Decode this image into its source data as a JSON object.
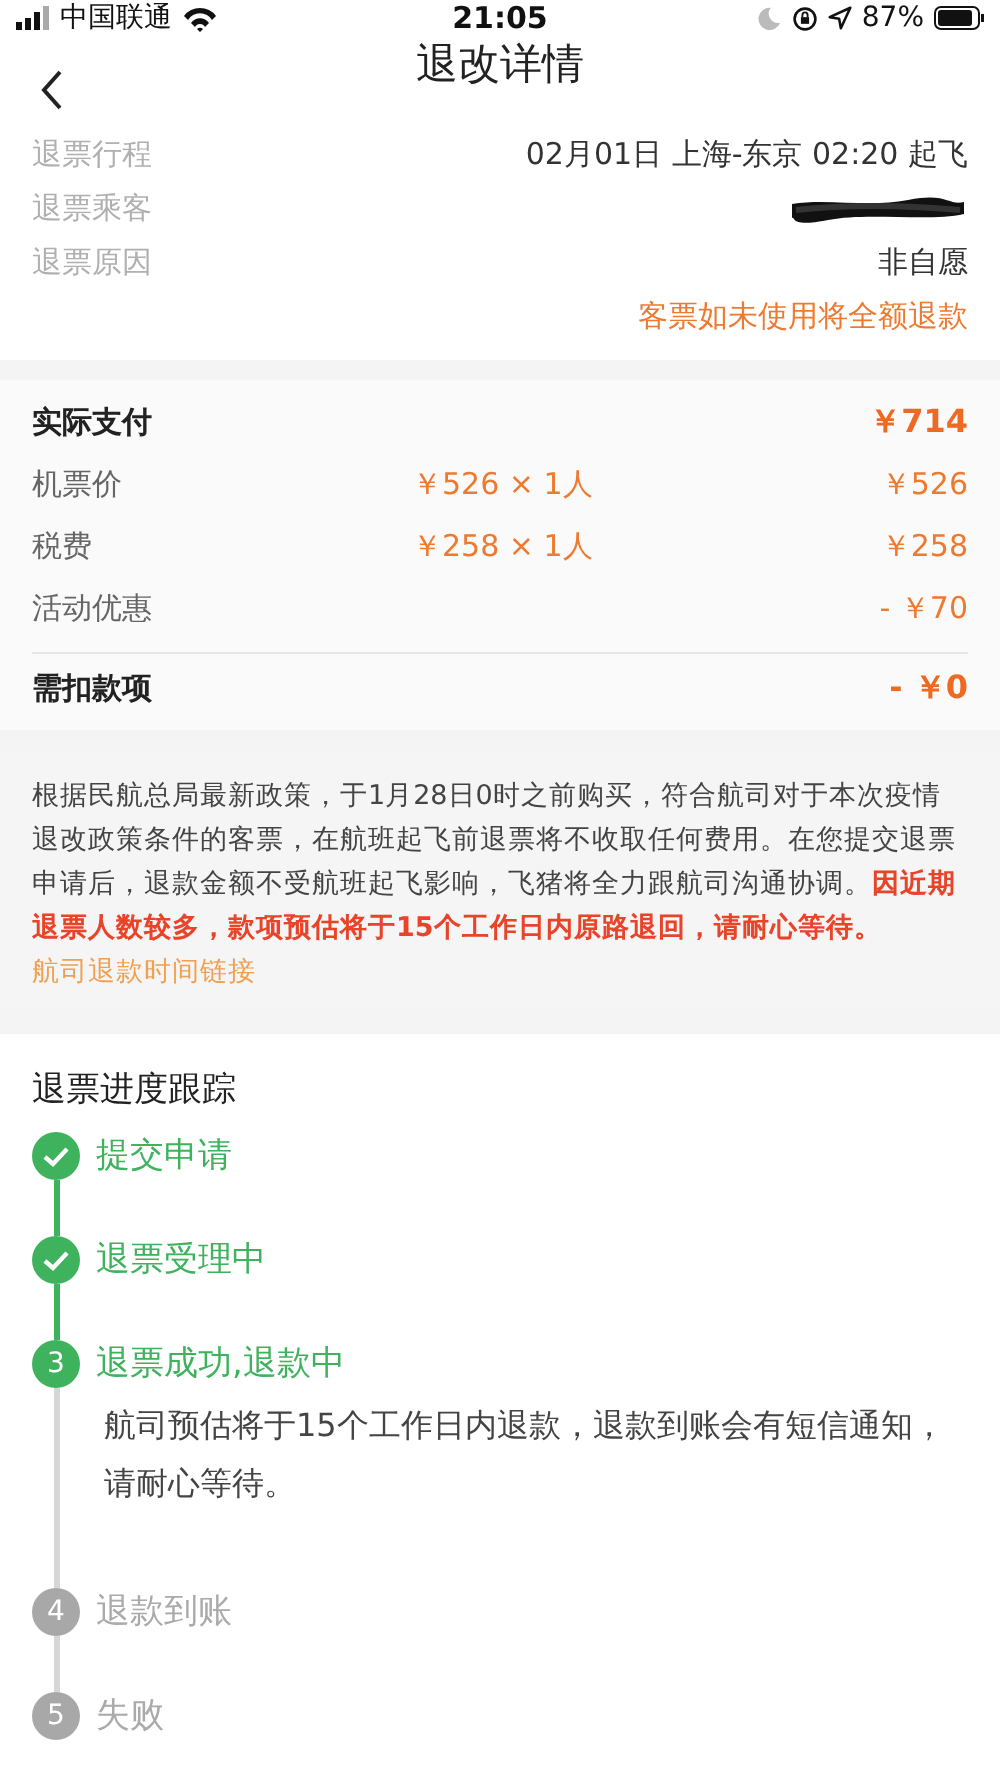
{
  "status_bar": {
    "carrier": "中国联通",
    "time": "21:05",
    "battery": "87%"
  },
  "nav": {
    "title": "退改详情"
  },
  "info": {
    "rows": [
      {
        "label": "退票行程",
        "kind": "text",
        "value": "02月01日 上海-东京 02:20 起飞"
      },
      {
        "label": "退票乘客",
        "kind": "redacted"
      },
      {
        "label": "退票原因",
        "kind": "text",
        "value": "非自愿"
      }
    ],
    "note": "客票如未使用将全额退款"
  },
  "prices": [
    {
      "kind": "total",
      "label": "实际支付",
      "amount": "￥714"
    },
    {
      "kind": "item",
      "label": "机票价",
      "unit": "￥526 × 1人",
      "amount": "￥526"
    },
    {
      "kind": "item",
      "label": "税费",
      "unit": "￥258 × 1人",
      "amount": "￥258"
    },
    {
      "kind": "item",
      "label": "活动优惠",
      "amount": "- ￥70"
    },
    {
      "kind": "total",
      "label": "需扣款项",
      "amount": "- ￥0"
    }
  ],
  "notice": {
    "text": "根据民航总局最新政策，于1月28日0时之前购买，符合航司对于本次疫情退改政策条件的客票，在航班起飞前退票将不收取任何费用。在您提交退票申请后，退款金额不受航班起飞影响，飞猪将全力跟航司沟通协调。**因近期退票人数较多，款项预估将于15个工作日内原路退回，请耐心等待。**",
    "link": "航司退款时间链接"
  },
  "progress": {
    "title": "退票进度跟踪",
    "steps": [
      {
        "completed": true,
        "active": false,
        "label": "提交申请"
      },
      {
        "completed": true,
        "active": false,
        "label": "退票受理中"
      },
      {
        "completed": false,
        "active": true,
        "number": "3",
        "label": "退票成功,退款中",
        "detail": "航司预估将于15个工作日内退款，退款到账会有短信通知，请耐心等待。"
      },
      {
        "completed": false,
        "active": false,
        "number": "4",
        "label": "退款到账"
      },
      {
        "completed": false,
        "active": false,
        "number": "5",
        "label": "失败"
      }
    ]
  }
}
